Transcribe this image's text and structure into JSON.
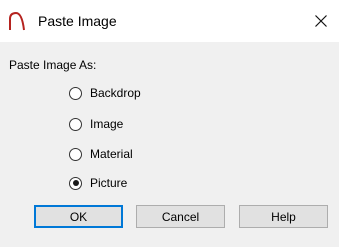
{
  "window": {
    "title": "Paste Image",
    "icon": "arc-app-icon",
    "close_icon": "close-icon"
  },
  "group": {
    "label": "Paste Image As:",
    "options": [
      {
        "label": "Backdrop",
        "checked": false
      },
      {
        "label": "Image",
        "checked": false
      },
      {
        "label": "Material",
        "checked": false
      },
      {
        "label": "Picture",
        "checked": true
      }
    ]
  },
  "buttons": {
    "ok": "OK",
    "cancel": "Cancel",
    "help": "Help"
  },
  "colors": {
    "icon_arc": "#b5231f",
    "default_button_border": "#0078d7",
    "panel_background": "#f0f0f0"
  }
}
